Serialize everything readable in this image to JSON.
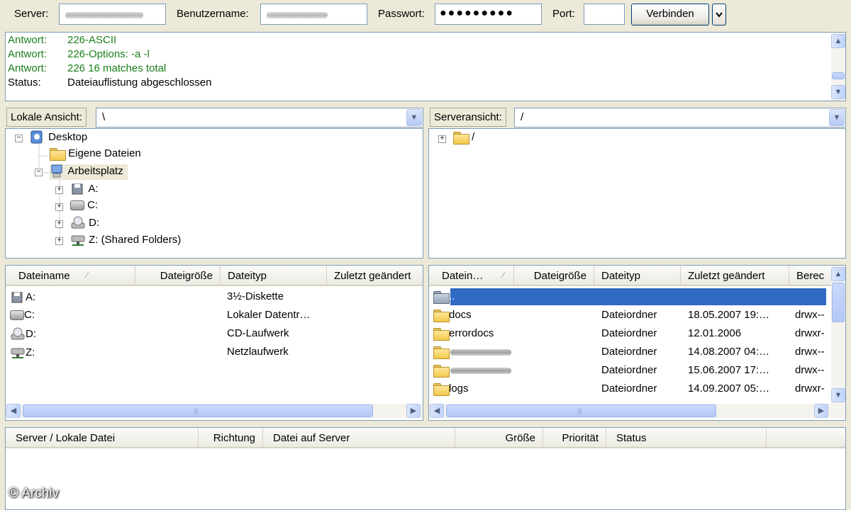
{
  "quickconnect": {
    "server_label": "Server:",
    "user_label": "Benutzername:",
    "password_label": "Passwort:",
    "password_value": "●●●●●●●●●",
    "port_label": "Port:",
    "port_value": "",
    "connect_label": "Verbinden"
  },
  "log": [
    {
      "key": "Antwort:",
      "value": "226-ASCII",
      "color": "#1A7F1A"
    },
    {
      "key": "Antwort:",
      "value": "226-Options: -a -l",
      "color": "#1A7F1A"
    },
    {
      "key": "Antwort:",
      "value": "226 16 matches total",
      "color": "#1A7F1A"
    },
    {
      "key": "Status:",
      "value": "Dateiauflistung abgeschlossen",
      "color": "#000000"
    }
  ],
  "local": {
    "label": "Lokale Ansicht:",
    "path": "\\",
    "tree": [
      {
        "label": "Desktop",
        "icon": "desktop-icon"
      },
      {
        "label": "Eigene Dateien",
        "icon": "documents-icon"
      },
      {
        "label": "Arbeitsplatz",
        "icon": "computer-icon"
      },
      {
        "label": "A:",
        "icon": "floppy-icon"
      },
      {
        "label": "C:",
        "icon": "harddisk-icon"
      },
      {
        "label": "D:",
        "icon": "cdrom-icon"
      },
      {
        "label": "Z: (Shared Folders)",
        "icon": "network-drive-icon"
      }
    ],
    "columns": [
      "Dateiname",
      "Dateigröße",
      "Dateityp",
      "Zuletzt geändert"
    ],
    "rows": [
      {
        "name": "A:",
        "type": "3½-Diskette",
        "icon": "floppy-icon"
      },
      {
        "name": "C:",
        "type": "Lokaler Datentr…",
        "icon": "harddisk-icon"
      },
      {
        "name": "D:",
        "type": "CD-Laufwerk",
        "icon": "cdrom-icon"
      },
      {
        "name": "Z:",
        "type": "Netzlaufwerk",
        "icon": "network-drive-icon"
      }
    ]
  },
  "remote": {
    "label": "Serveransicht:",
    "path": "/",
    "tree": [
      {
        "label": "/",
        "icon": "folder-icon"
      }
    ],
    "columns": [
      "Datein…",
      "Dateigröße",
      "Dateityp",
      "Zuletzt geändert",
      "Berec"
    ],
    "rows": [
      {
        "name": "..",
        "type": "",
        "date": "",
        "perm": "",
        "selected": true
      },
      {
        "name": "docs",
        "type": "Dateiordner",
        "date": "18.05.2007 19:…",
        "perm": "drwx--"
      },
      {
        "name": "errordocs",
        "type": "Dateiordner",
        "date": "12.01.2006",
        "perm": "drwxr-"
      },
      {
        "name": "",
        "type": "Dateiordner",
        "date": "14.08.2007 04:…",
        "perm": "drwx--"
      },
      {
        "name": "",
        "type": "Dateiordner",
        "date": "15.06.2007 17:…",
        "perm": "drwx--"
      },
      {
        "name": "logs",
        "type": "Dateiordner",
        "date": "14.09.2007 05:…",
        "perm": "drwxr-"
      }
    ]
  },
  "queue": {
    "columns": [
      "Server / Lokale Datei",
      "Richtung",
      "Datei auf Server",
      "Größe",
      "Priorität",
      "Status"
    ]
  },
  "watermark": "© Archiv"
}
